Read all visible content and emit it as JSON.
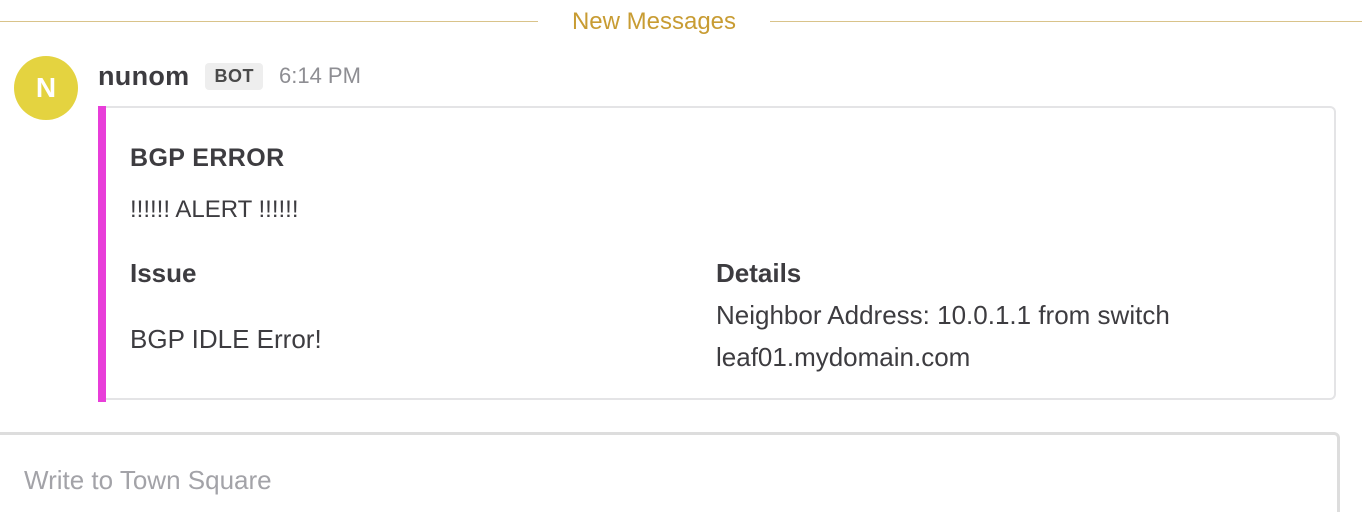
{
  "separator": {
    "label": "New Messages",
    "color": "#c89c33"
  },
  "post": {
    "avatar_initial": "N",
    "avatar_color": "#e4d340",
    "username": "nunom",
    "badge": "BOT",
    "time": "6:14 PM",
    "attachment": {
      "accent_color": "#e83ed9",
      "title": "BGP ERROR",
      "text": "!!!!!! ALERT !!!!!!",
      "fields": [
        {
          "title": "Issue",
          "value": "BGP IDLE Error!"
        },
        {
          "title": "Details",
          "value": "Neighbor Address: 10.0.1.1 from switch leaf01.mydomain.com"
        }
      ]
    }
  },
  "composer": {
    "placeholder": "Write to Town Square",
    "value": ""
  }
}
